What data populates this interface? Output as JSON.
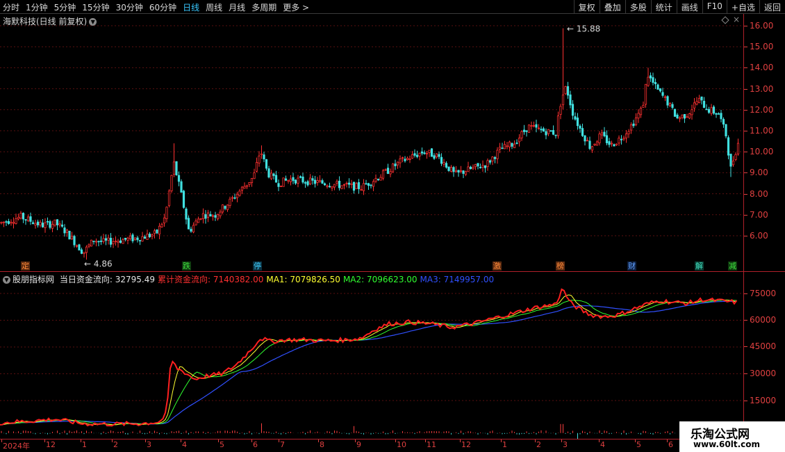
{
  "toolbar": {
    "periods": [
      "分时",
      "1分钟",
      "5分钟",
      "15分钟",
      "30分钟",
      "60分钟",
      "日线",
      "周线",
      "月线",
      "多周期",
      "更多 >"
    ],
    "active_period": "日线",
    "tools": [
      "复权",
      "叠加",
      "多股",
      "统计",
      "画线",
      "F10",
      "+自选",
      "返回"
    ]
  },
  "stock": {
    "title": "海默科技(日线 前复权)"
  },
  "price_panel": {
    "max_label": "15.88",
    "min_label": "4.86",
    "y_ticks": [
      "16.00",
      "15.00",
      "14.00",
      "13.00",
      "12.00",
      "11.00",
      "10.00",
      "9.00",
      "8.00",
      "7.00",
      "6.00"
    ],
    "tags": [
      {
        "text": "定",
        "color": "#ff8a3a",
        "bg": "#5a2a10"
      },
      {
        "text": "跌",
        "color": "#40e040",
        "bg": "#0e3a0e"
      },
      {
        "text": "停",
        "color": "#40d0ff",
        "bg": "#0a3040"
      },
      {
        "text": "激",
        "color": "#ff8a3a",
        "bg": "#5a2a10"
      },
      {
        "text": "榜",
        "color": "#ff8a3a",
        "bg": "#5a2a10"
      },
      {
        "text": "财",
        "color": "#60a0ff",
        "bg": "#0e2040"
      },
      {
        "text": "解",
        "color": "#40e0c0",
        "bg": "#0a3a30"
      },
      {
        "text": "减",
        "color": "#40e040",
        "bg": "#0e3a0e"
      }
    ]
  },
  "indicator": {
    "name": "股朋指标网",
    "items": [
      {
        "label": "当日资金流向: 32795.49",
        "color": "#e6e6e6"
      },
      {
        "label": "累计资金流向: 7140382.00",
        "color": "#ff3030"
      },
      {
        "label": "MA1: 7079826.50",
        "color": "#ffff30"
      },
      {
        "label": "MA2: 7096623.00",
        "color": "#30ff30"
      },
      {
        "label": "MA3: 7149957.00",
        "color": "#3050ff"
      }
    ],
    "y_ticks": [
      "75000",
      "60000",
      "45000",
      "30000",
      "15000"
    ]
  },
  "date_axis": [
    "2024年",
    "12",
    "1",
    "2",
    "3",
    "4",
    "5",
    "6",
    "7",
    "8",
    "9",
    "10",
    "11",
    "12",
    "1",
    "2",
    "3",
    "4",
    "5",
    "6"
  ],
  "watermark": {
    "title": "乐淘公式网",
    "url": "www.60lt.com"
  },
  "colors": {
    "up": "#ff3030",
    "down": "#40e0e0",
    "grid": "#5a1010",
    "axis": "#e04040"
  }
}
